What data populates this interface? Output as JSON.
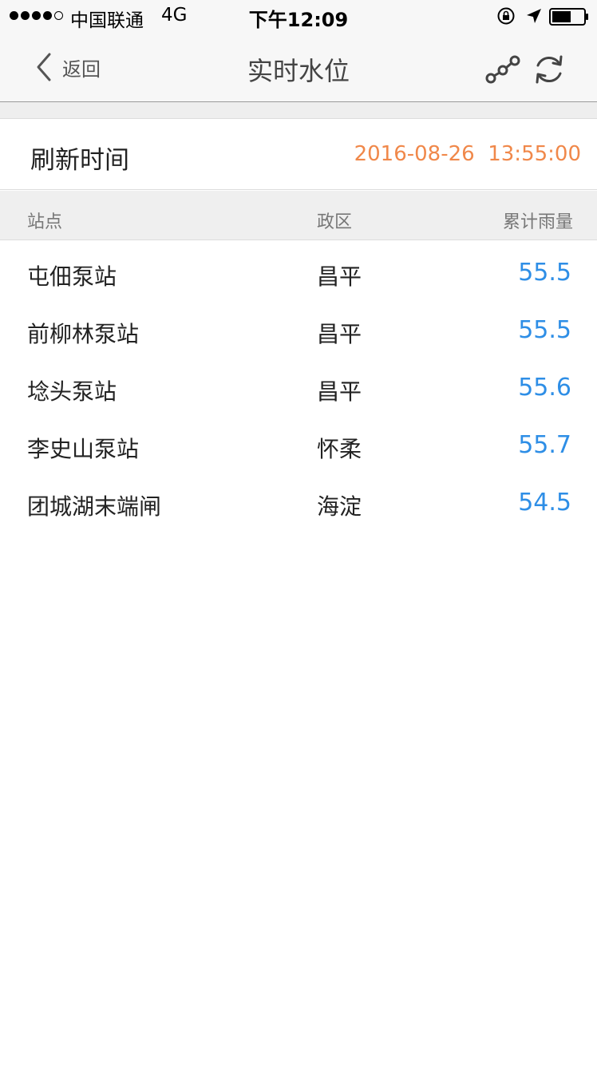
{
  "status_bar": {
    "carrier": "中国联通",
    "network": "4G",
    "time": "下午12:09",
    "signal_strength": 4,
    "battery_level": 0.6
  },
  "nav": {
    "back_label": "返回",
    "title": "实时水位",
    "chart_icon": "line-chart-icon",
    "refresh_icon": "refresh-icon"
  },
  "refresh": {
    "label": "刷新时间",
    "value": "2016-08-26  13:55:00"
  },
  "table": {
    "headers": [
      "站点",
      "政区",
      "累计雨量"
    ],
    "rows": [
      {
        "station": "屯佃泵站",
        "district": "昌平",
        "rainfall": "55.5"
      },
      {
        "station": "前柳林泵站",
        "district": "昌平",
        "rainfall": "55.5"
      },
      {
        "station": "埝头泵站",
        "district": "昌平",
        "rainfall": "55.6"
      },
      {
        "station": "李史山泵站",
        "district": "怀柔",
        "rainfall": "55.7"
      },
      {
        "station": "团城湖末端闸",
        "district": "海淀",
        "rainfall": "54.5"
      }
    ]
  },
  "colors": {
    "accent_orange": "#f0884a",
    "value_blue": "#2e8ee6"
  }
}
